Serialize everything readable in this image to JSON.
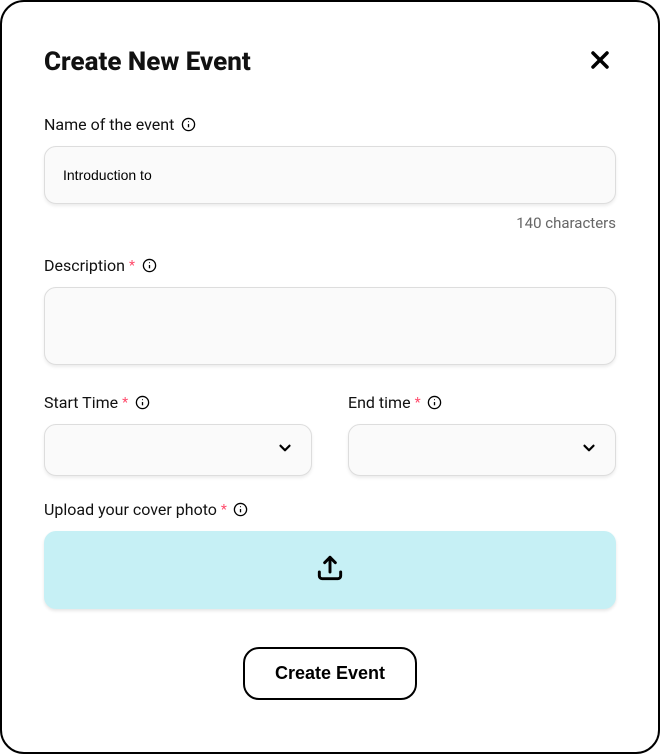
{
  "modal": {
    "title": "Create New Event",
    "name_field": {
      "label": "Name of the event",
      "value": "Introduction to",
      "char_count": "140 characters"
    },
    "description_field": {
      "label": "Description",
      "value": ""
    },
    "start_time": {
      "label": "Start Time",
      "value": ""
    },
    "end_time": {
      "label": "End time",
      "value": ""
    },
    "upload": {
      "label": "Upload your cover photo"
    },
    "submit_label": "Create Event"
  }
}
